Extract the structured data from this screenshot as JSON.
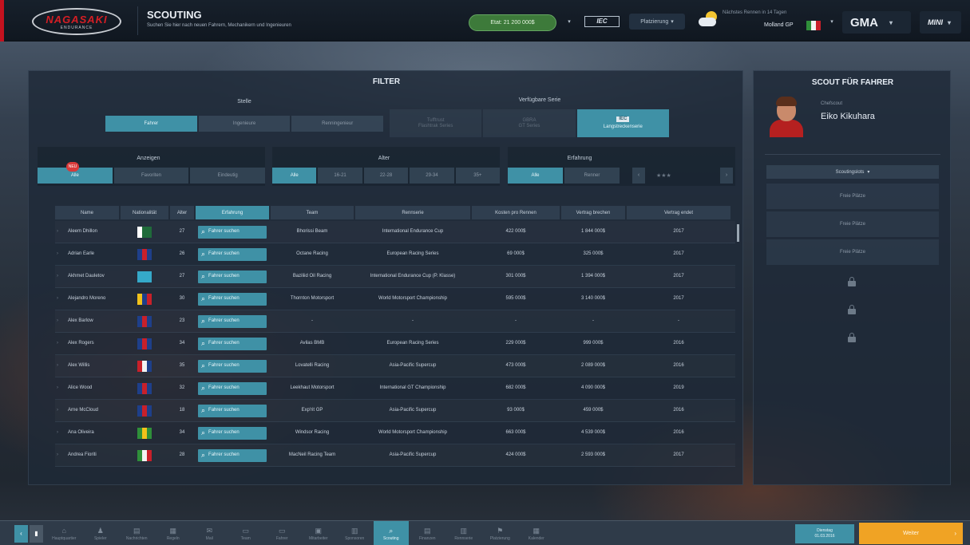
{
  "header": {
    "logo_main": "NAGASAKI",
    "logo_sub": "ENDURANCE",
    "title": "SCOUTING",
    "subtitle": "Suchen Sie hier nach neuen Fahrern, Mechanikern und Ingenieuren",
    "budget": "Etat: 21 200 000$",
    "series_logo": "IEC",
    "standings_btn": "Platzierung",
    "next_race_label": "Nächstes Rennen in 14 Tagen",
    "next_race_track": "Molland GP",
    "next_race_flag_colors": [
      "#2f8f3a",
      "#f2f2f2",
      "#c8202a"
    ],
    "team_short": "GMA",
    "brand_short": "MINI"
  },
  "filter": {
    "title": "FILTER",
    "role_label": "Stelle",
    "roles": [
      "Fahrer",
      "Ingenieure",
      "Renningenieur"
    ],
    "active_role": 0,
    "series_label": "Verfügbare Serie",
    "series": [
      "Tufftrust\nFlashtrak Series",
      "GBRA\nGT Series",
      "Langstreckenserie"
    ],
    "active_series": 2,
    "show_label": "Anzeigen",
    "show_opts": [
      "Alle",
      "Favoriten",
      "Eindeutig"
    ],
    "active_show": 0,
    "badge": "NEU",
    "age_label": "Alter",
    "age_opts": [
      "Alle",
      "16-21",
      "22-28",
      "29-34",
      "35+"
    ],
    "active_age": 0,
    "exp_label": "Erfahrung",
    "exp_opts": [
      "Alle",
      "Renner"
    ],
    "active_exp": 0,
    "stars": "★★★"
  },
  "table": {
    "columns": [
      "Name",
      "Nationalität",
      "Alter",
      "Erfahrung",
      "Team",
      "Rennserie",
      "Kosten pro Rennen",
      "Vertrag brechen",
      "Vertrag endet"
    ],
    "active_column": 3,
    "search_label": "Fahrer suchen",
    "rows": [
      {
        "name": "Aleem Dhillon",
        "flag": [
          "#ffffff",
          "#1f6b3a",
          "#1f6b3a"
        ],
        "age": "27",
        "team": "Bhorissi Beam",
        "series": "International Endurance Cup",
        "cost": "422 000$",
        "break": "1 844 000$",
        "end": "2017"
      },
      {
        "name": "Adrian Earle",
        "flag": [
          "#1e3f8a",
          "#c8202a",
          "#1e3f8a"
        ],
        "age": "26",
        "team": "Octane Racing",
        "series": "European Racing Series",
        "cost": "69 000$",
        "break": "325 000$",
        "end": "2017"
      },
      {
        "name": "Akhmet Dauletov",
        "flag": [
          "#35a9c9",
          "#35a9c9",
          "#35a9c9"
        ],
        "age": "27",
        "team": "Baziliid Oil Racing",
        "series": "International Endurance Cup (P. Klasse)",
        "cost": "301 000$",
        "break": "1 394 000$",
        "end": "2017"
      },
      {
        "name": "Alejandro Moreno",
        "flag": [
          "#f2c21a",
          "#1e3f8a",
          "#c8202a"
        ],
        "age": "30",
        "team": "Thornton Motorsport",
        "series": "World Motorsport Championship",
        "cost": "595 000$",
        "break": "3 140 000$",
        "end": "2017"
      },
      {
        "name": "Alex Barlow",
        "flag": [
          "#1e3f8a",
          "#c8202a",
          "#1e3f8a"
        ],
        "age": "23",
        "team": "-",
        "series": "-",
        "cost": "-",
        "break": "-",
        "end": "-"
      },
      {
        "name": "Alex Rogers",
        "flag": [
          "#1e3f8a",
          "#c8202a",
          "#1e3f8a"
        ],
        "age": "34",
        "team": "Avilas BMB",
        "series": "European Racing Series",
        "cost": "229 000$",
        "break": "999 000$",
        "end": "2016"
      },
      {
        "name": "Alex Willis",
        "flag": [
          "#c8202a",
          "#f2f2f2",
          "#1e3f8a"
        ],
        "age": "35",
        "team": "Lovatelli Racing",
        "series": "Asia-Pacific Supercup",
        "cost": "473 000$",
        "break": "2 089 000$",
        "end": "2016"
      },
      {
        "name": "Alice Wood",
        "flag": [
          "#1e3f8a",
          "#c8202a",
          "#1e3f8a"
        ],
        "age": "32",
        "team": "Leekhaut Motorsport",
        "series": "International GT Championship",
        "cost": "682 000$",
        "break": "4 090 000$",
        "end": "2019"
      },
      {
        "name": "Arne McCloud",
        "flag": [
          "#1e3f8a",
          "#c8202a",
          "#1e3f8a"
        ],
        "age": "18",
        "team": "Exp'rit GP",
        "series": "Asia-Pacific Supercup",
        "cost": "93 000$",
        "break": "459 000$",
        "end": "2016"
      },
      {
        "name": "Ana Oliveira",
        "flag": [
          "#2f8f3a",
          "#f2c21a",
          "#2f8f3a"
        ],
        "age": "34",
        "team": "Windsor Racing",
        "series": "World Motorsport Championship",
        "cost": "663 000$",
        "break": "4 539 000$",
        "end": "2016"
      },
      {
        "name": "Andrea Fioriti",
        "flag": [
          "#2f8f3a",
          "#f2f2f2",
          "#c8202a"
        ],
        "age": "28",
        "team": "MacNeil Racing Team",
        "series": "Asia-Pacific Supercup",
        "cost": "424 000$",
        "break": "2 593 000$",
        "end": "2017"
      }
    ]
  },
  "scout": {
    "title": "SCOUT FÜR FAHRER",
    "role": "Chefscout",
    "name": "Eiko Kikuhara",
    "sort_label": "Scoutingslots",
    "slots": [
      "Freie Plätze",
      "Freie Plätze",
      "Freie Plätze"
    ]
  },
  "bottom_nav": {
    "items": [
      "Hauptquartier",
      "Spieler",
      "Nachrichten",
      "Regeln",
      "Mail",
      "Team",
      "Fahrer",
      "Mitarbeiter",
      "Sponsoren",
      "Scouting",
      "Finanzen",
      "Rennserie",
      "Platzierung",
      "Kalender"
    ],
    "icons": [
      "⌂",
      "♟",
      "▤",
      "▦",
      "✉",
      "▭",
      "▭",
      "▣",
      "▥",
      "⌕",
      "▤",
      "▥",
      "⚑",
      "▦"
    ],
    "active": 9,
    "date_line1": "Dienstag",
    "date_line2": "01.03.2016",
    "continue": "Weiter"
  }
}
